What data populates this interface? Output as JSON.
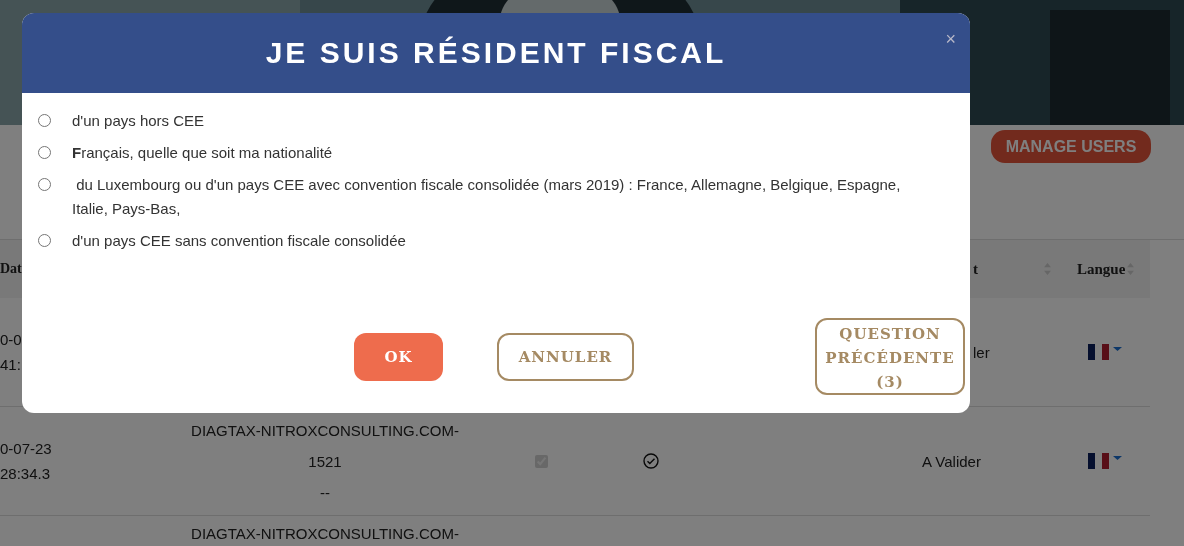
{
  "page": {
    "manage_users_button": "MANAGE USERS",
    "table": {
      "columns": [
        {
          "label": "Dat",
          "sortable": false
        },
        {
          "label": "t",
          "sortable": true
        },
        {
          "label": "Langue",
          "sortable": true
        }
      ],
      "rows": [
        {
          "date_lines": [
            "0-0",
            "41:"
          ],
          "status": "ler"
        },
        {
          "date_lines": [
            "0-07-23",
            "28:34.3"
          ],
          "reference_lines": [
            "DIAGTAX-NITROXCONSULTING.COM-",
            "1521",
            "--"
          ],
          "checkbox": {
            "checked": true,
            "disabled": true
          },
          "status": "A Valider"
        },
        {
          "reference_lines": [
            "DIAGTAX-NITROXCONSULTING.COM-"
          ]
        }
      ]
    }
  },
  "modal": {
    "title": "JE SUIS RÉSIDENT FISCAL",
    "close": "×",
    "options": [
      {
        "label": "d'un pays hors CEE",
        "selected": false
      },
      {
        "label": "**F**rançais, quelle que soit ma nationalité",
        "selected": false
      },
      {
        "label": " du Luxembourg ou d'un pays CEE avec convention fiscale consolidée (mars 2019) : France, Allemagne, Belgique, Espagne, Italie, Pays-Bas,",
        "selected": false
      },
      {
        "label": "d'un pays CEE sans convention fiscale consolidée",
        "selected": false
      }
    ],
    "buttons": [
      {
        "label": "OK",
        "kind": "primary"
      },
      {
        "label": "ANNULER",
        "kind": "outline"
      },
      {
        "label": "QUESTION PRÉCÉDENTE (3)",
        "kind": "outline"
      }
    ]
  }
}
